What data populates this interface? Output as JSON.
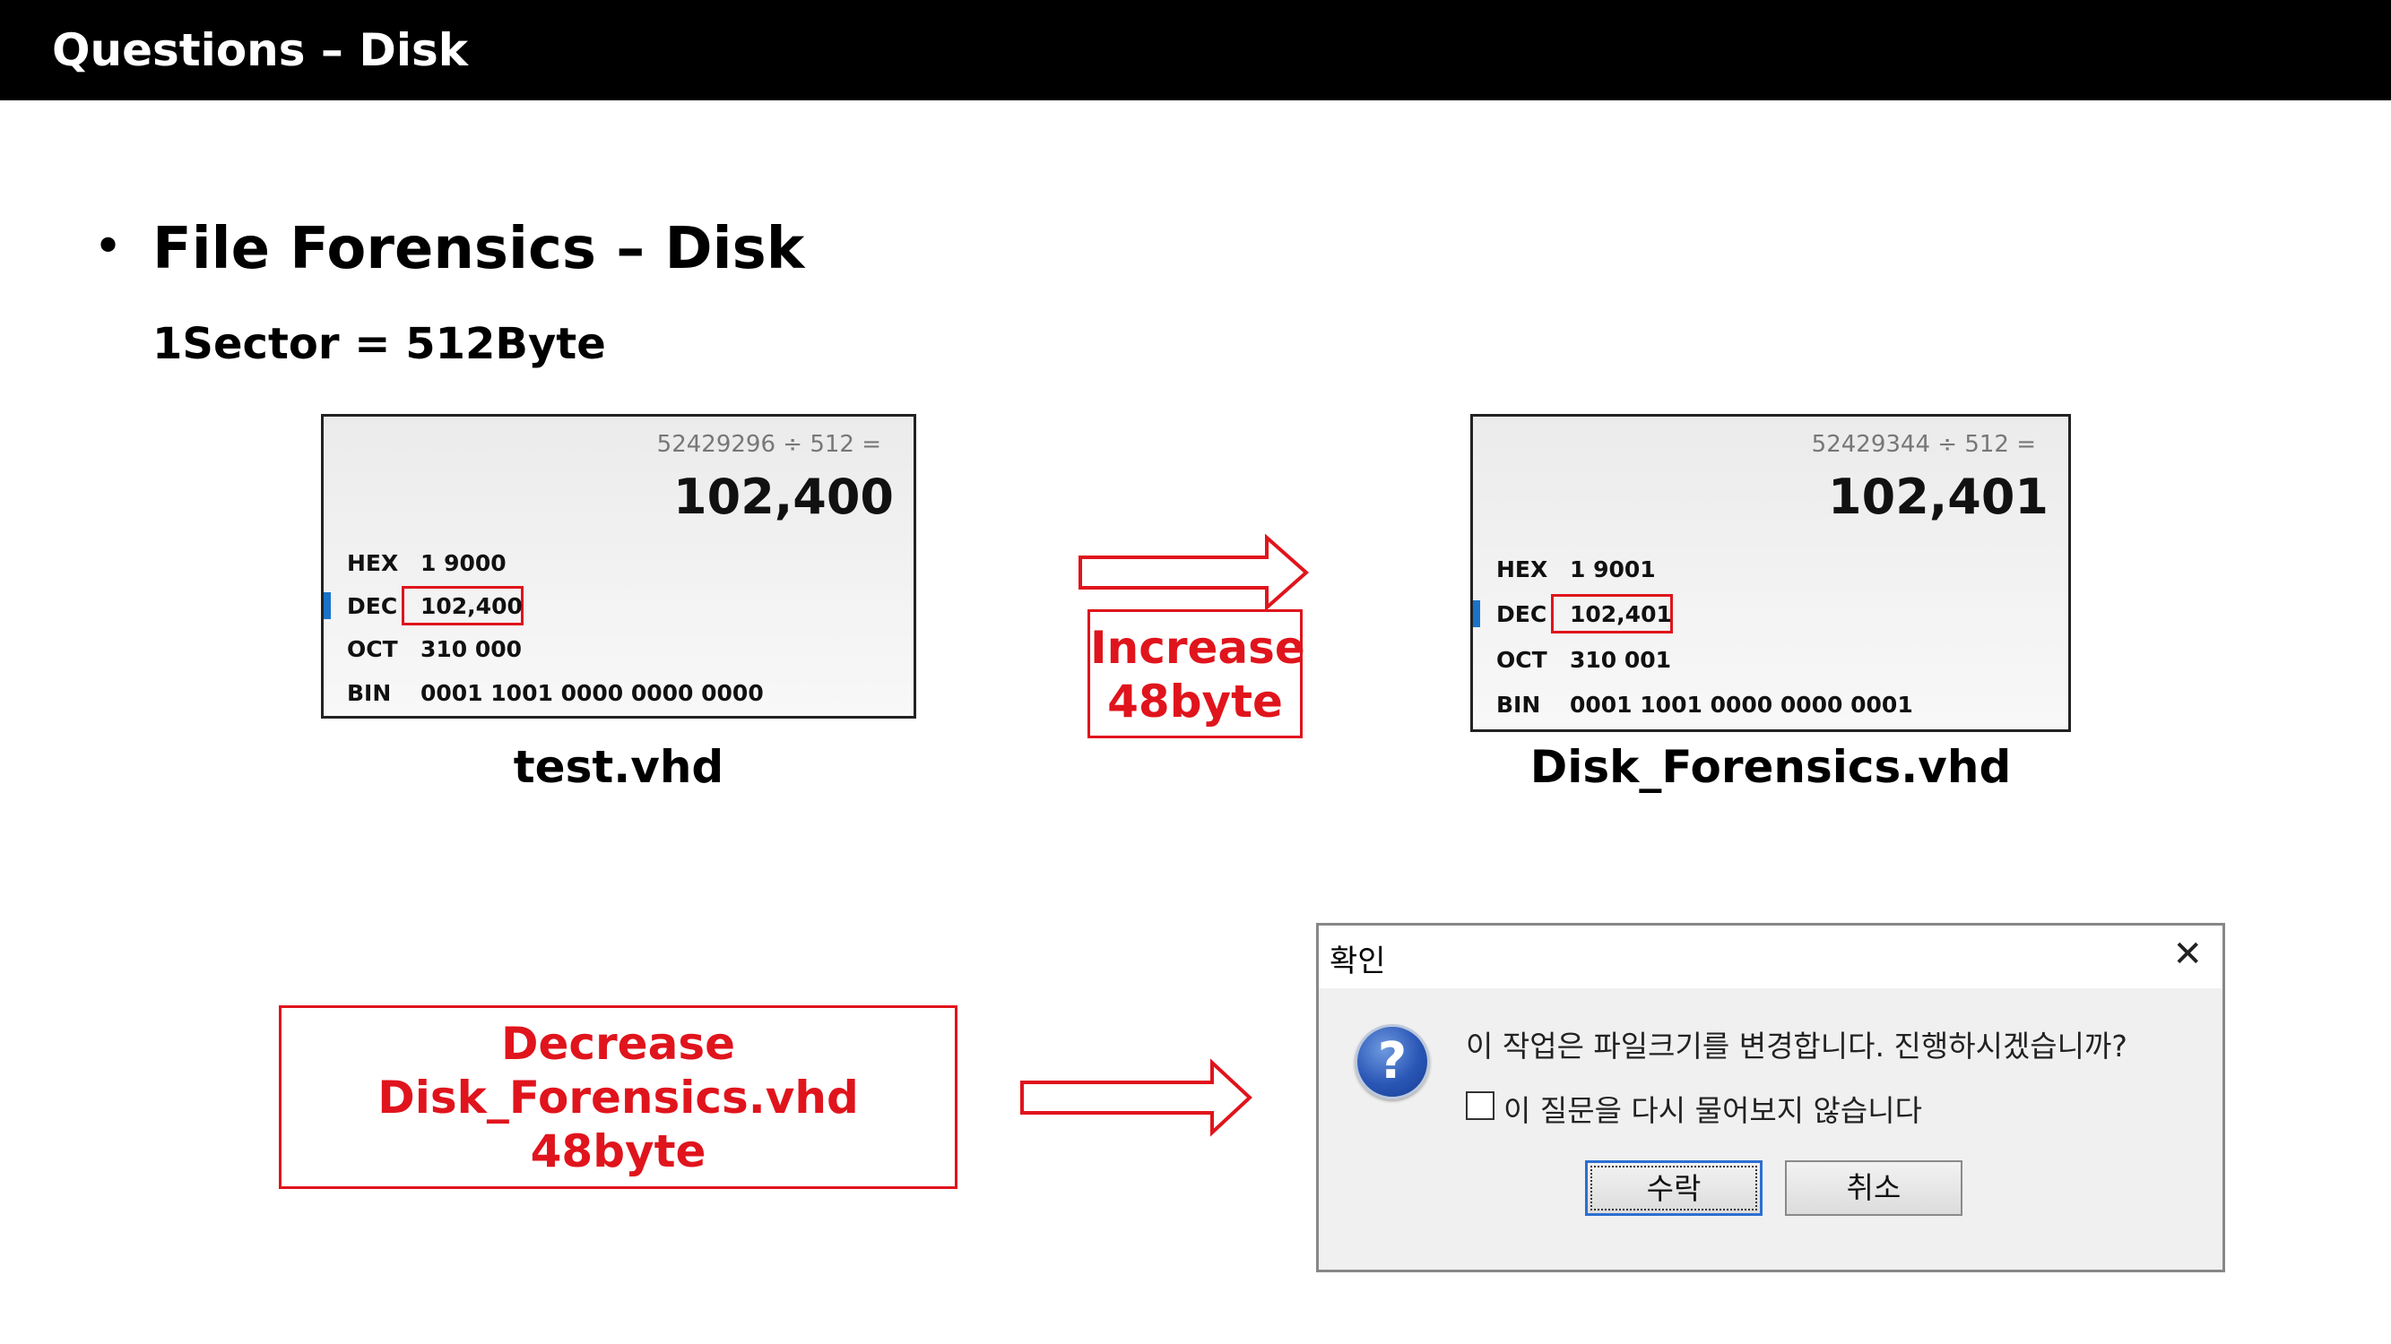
{
  "header": {
    "title": "Questions – Disk"
  },
  "section": {
    "bullet": "•",
    "title": "File Forensics – Disk",
    "note": "1Sector  =  512Byte"
  },
  "calc_left": {
    "expression": "52429296 ÷ 512 =",
    "result": "102,400",
    "rows": [
      {
        "label": "HEX",
        "value": "1 9000"
      },
      {
        "label": "DEC",
        "value": "102,400"
      },
      {
        "label": "OCT",
        "value": "310 000"
      },
      {
        "label": "BIN",
        "value": "0001 1001 0000 0000 0000"
      }
    ],
    "caption": "test.vhd"
  },
  "calc_right": {
    "expression": "52429344 ÷ 512 =",
    "result": "102,401",
    "rows": [
      {
        "label": "HEX",
        "value": "1 9001"
      },
      {
        "label": "DEC",
        "value": "102,401"
      },
      {
        "label": "OCT",
        "value": "310 001"
      },
      {
        "label": "BIN",
        "value": "0001 1001 0000 0000 0001"
      }
    ],
    "caption": "Disk_Forensics.vhd"
  },
  "increase_box": {
    "line1": "Increase",
    "line2": "48byte"
  },
  "decrease_box": {
    "line1": "Decrease",
    "line2": "Disk_Forensics.vhd",
    "line3": "48byte"
  },
  "dialog": {
    "title": "확인",
    "close_icon": "close-icon",
    "help_icon_glyph": "?",
    "message": "이 작업은 파일크기를 변경합니다. 진행하시겠습니까?",
    "checkbox_label": "이 질문을 다시 물어보지 않습니다",
    "accept_label": "수락",
    "cancel_label": "취소"
  },
  "colors": {
    "accent_red": "#e0141c",
    "header_bg": "#000000",
    "selection_blue": "#1a73c9"
  }
}
